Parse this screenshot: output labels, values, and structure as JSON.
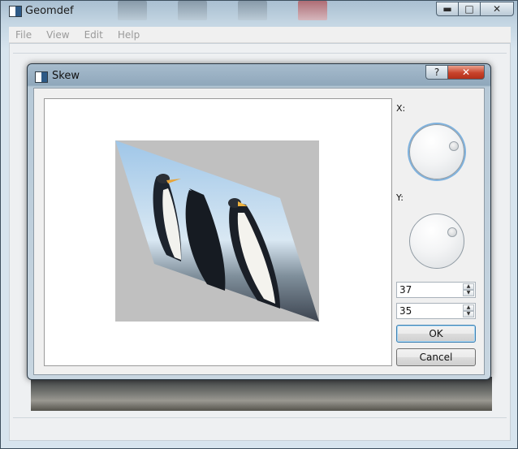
{
  "main_window": {
    "title": "Geomdef",
    "caption": {
      "minimize": "▬",
      "maximize": "□",
      "close": "✕"
    },
    "menu": [
      "File",
      "View",
      "Edit",
      "Help"
    ]
  },
  "dialog": {
    "title": "Skew",
    "caption": {
      "help": "?",
      "close": "✕"
    },
    "x_label": "X:",
    "y_label": "Y:",
    "x_value": "37",
    "y_value": "35",
    "ok_label": "OK",
    "cancel_label": "Cancel"
  },
  "colors": {
    "preview_background": "#ffffff",
    "skew_backdrop": "#c0c0c0",
    "default_button_border": "#3c7fb1"
  }
}
